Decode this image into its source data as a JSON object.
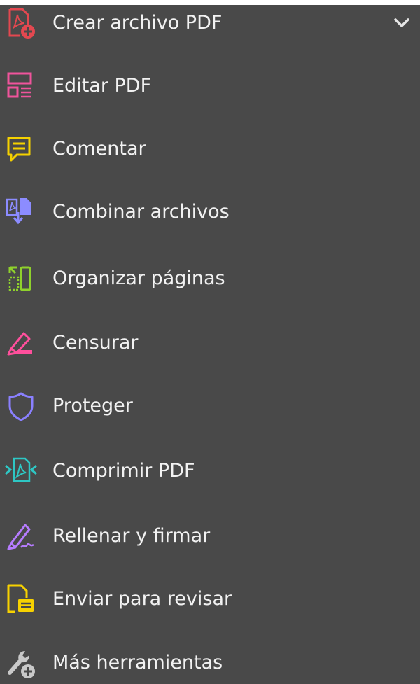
{
  "menu": {
    "items": [
      {
        "label": "Crear archivo PDF",
        "icon": "create-pdf-icon",
        "color": "#e34850"
      },
      {
        "label": "Editar PDF",
        "icon": "edit-pdf-icon",
        "color": "#f0549c"
      },
      {
        "label": "Comentar",
        "icon": "comment-icon",
        "color": "#f5d100"
      },
      {
        "label": "Combinar archivos",
        "icon": "combine-files-icon",
        "color": "#8c8cff"
      },
      {
        "label": "Organizar páginas",
        "icon": "organize-pages-icon",
        "color": "#8fd12c"
      },
      {
        "label": "Censurar",
        "icon": "redact-icon",
        "color": "#ff4f9c"
      },
      {
        "label": "Proteger",
        "icon": "shield-icon",
        "color": "#8a80ff"
      },
      {
        "label": "Comprimir PDF",
        "icon": "compress-pdf-icon",
        "color": "#2ec7c4"
      },
      {
        "label": "Rellenar y firmar",
        "icon": "fill-sign-icon",
        "color": "#b67cff"
      },
      {
        "label": "Enviar para revisar",
        "icon": "send-review-icon",
        "color": "#f7d100"
      },
      {
        "label": "Más herramientas",
        "icon": "more-tools-icon",
        "color": "#c9c9c9"
      }
    ],
    "expand_icon": "chevron-down-icon"
  }
}
